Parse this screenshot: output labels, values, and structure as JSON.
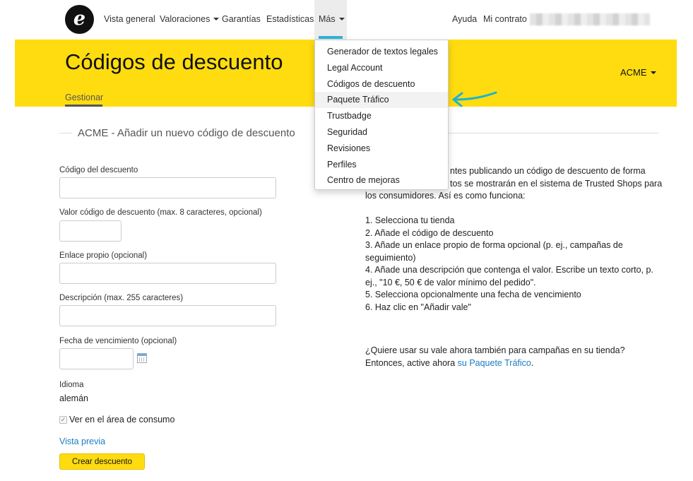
{
  "nav": {
    "logo_letter": "e",
    "items": [
      "Vista general",
      "Valoraciones",
      "Garantías",
      "Estadísticas",
      "Más"
    ],
    "right_items": [
      "Ayuda",
      "Mi contrato"
    ],
    "accent_color": "#2bb5d8"
  },
  "header": {
    "title": "Códigos de descuento",
    "shop_selector": "ACME",
    "tab_manage": "Gestionar",
    "bg_color": "#ffdc0f"
  },
  "dropdown": {
    "items": [
      "Generador de textos legales",
      "Legal Account",
      "Códigos de descuento",
      "Paquete Tráfico",
      "Trustbadge",
      "Seguridad",
      "Revisiones",
      "Perfiles",
      "Centro de mejoras"
    ],
    "highlighted_item": "Paquete Tráfico"
  },
  "section": {
    "title": "ACME - Añadir un nuevo código de descuento"
  },
  "form": {
    "code_label": "Código del descuento",
    "value_label": "Valor código de descuento (max. 8 caracteres, opcional)",
    "link_label": "Enlace propio (opcional)",
    "description_label": "Descripción (max. 255 caracteres)",
    "expiry_label": "Fecha de vencimiento (opcional)",
    "language_label": "Idioma",
    "language_value": "alemán",
    "checkbox_mark": "✓",
    "checkbox_label": "Ver en el área de consumo",
    "preview_link": "Vista previa",
    "submit_label": "Crear descuento"
  },
  "info": {
    "intro_lines": [
      "ntes publicando un código de descuento de forma",
      "tos se mostrarán en el sistema de Trusted Shops para",
      "los consumidores. Así es como funciona:"
    ],
    "steps": [
      "1. Selecciona tu tienda",
      "2. Añade el código de descuento",
      "3. Añade un enlace propio de forma opcional (p. ej., campañas de",
      "seguimiento)",
      "4. Añade una descripción que contenga el valor. Escribe un texto corto, p.",
      "ej., \"10 €, 50 € de valor mínimo del pedido\".",
      "5. Selecciona opcionalmente una fecha de vencimiento",
      "6. Haz clic en \"Añadir vale\""
    ],
    "outro_line1": "¿Quiere usar su vale ahora también para campañas en su tienda?",
    "outro_line2_prefix": "Entonces, active ahora ",
    "outro_link": "su Paquete Tráfico",
    "outro_suffix": "."
  }
}
